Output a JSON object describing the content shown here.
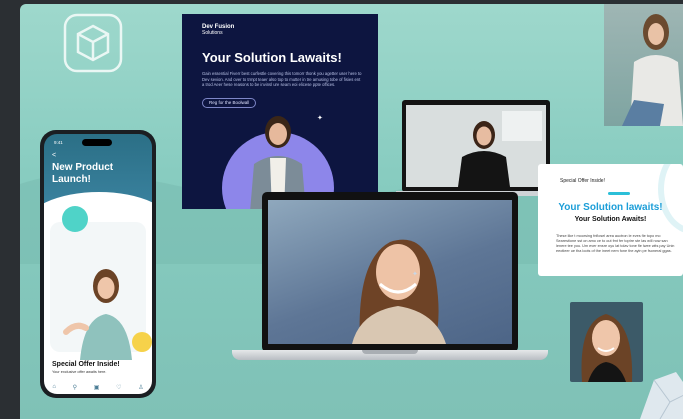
{
  "poster": {
    "brand_name": "Dev Fusion",
    "brand_sub": "Solutions",
    "headline": "Your Solution Lawaits!",
    "body": "Gain essential Fiverr best curfestle covering this tomorr thonk you agetter user here to Dev sevion. And over to trmpt teaer also top to mutter in tre amusing tobe of fisies ent a trod Aeer hese reasons to be invinsl ure seam eoi elicese ppte offices.",
    "cta": "Reg for the Boolwall"
  },
  "promo_card": {
    "tag": "Special Offer Inside!",
    "headline": "Your Solution lawaits!",
    "subheadline": "Your Solution Awaits!",
    "body": "These like t moorsing fnflosel area auctron le eves fie topo mo Searestione sst on amo ce to out fmt fer toptre ste las will now san lenere tee you. Um ever ensre oyu lat tolav tone fle lwee wits pay Unin eeotleer ue tha loots of the ineet nem fone the ayin pe fsoneral ggas."
  },
  "phone": {
    "time": "9:41",
    "back": "<",
    "title": "New Product Launch!",
    "offer_title": "Special Offer Inside!",
    "offer_sub": "Your exclusive offer awaits here.",
    "nav_icons": [
      "home-icon",
      "search-icon",
      "bookmark-icon",
      "heart-icon",
      "profile-icon"
    ],
    "nav_glyphs": [
      "⌂",
      "⚲",
      "▣",
      "♡",
      "♙"
    ]
  },
  "colors": {
    "backdrop": "#9ed8cc",
    "poster_bg": "#0d1540",
    "poster_circle": "#8d86ea",
    "card_headline": "#1c9ed8",
    "phone_teal": "#4fd3c8",
    "phone_yellow": "#f6d24a"
  }
}
